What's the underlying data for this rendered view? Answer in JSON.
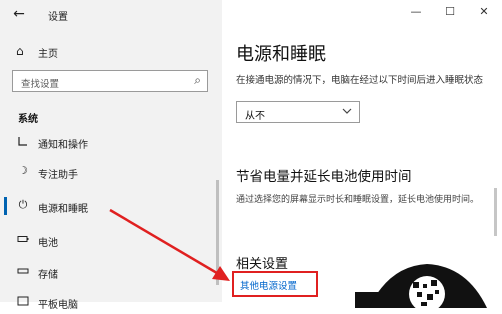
{
  "window": {
    "title": "设置"
  },
  "sidebar": {
    "home_label": "主页",
    "search_placeholder": "查找设置",
    "section": "系统",
    "items": [
      {
        "label": "通知和操作",
        "icon": "notification-icon"
      },
      {
        "label": "专注助手",
        "icon": "moon-icon"
      },
      {
        "label": "电源和睡眠",
        "icon": "power-icon",
        "active": true
      },
      {
        "label": "电池",
        "icon": "battery-icon"
      },
      {
        "label": "存储",
        "icon": "storage-icon"
      },
      {
        "label": "平板电脑",
        "icon": "tablet-icon"
      }
    ]
  },
  "main": {
    "title": "电源和睡眠",
    "sleep_desc": "在接通电源的情况下，电脑在经过以下时间后进入睡眠状态",
    "sleep_value": "从不",
    "battery_heading": "节省电量并延长电池使用时间",
    "battery_desc": "通过选择您的屏幕显示时长和睡眠设置，延长电池使用时间。",
    "related_heading": "相关设置",
    "related_link": "其他电源设置"
  },
  "colors": {
    "accent": "#0063b1",
    "link": "#0066cc",
    "highlight": "#e02020",
    "sidebar_bg": "#f2f2f2"
  }
}
